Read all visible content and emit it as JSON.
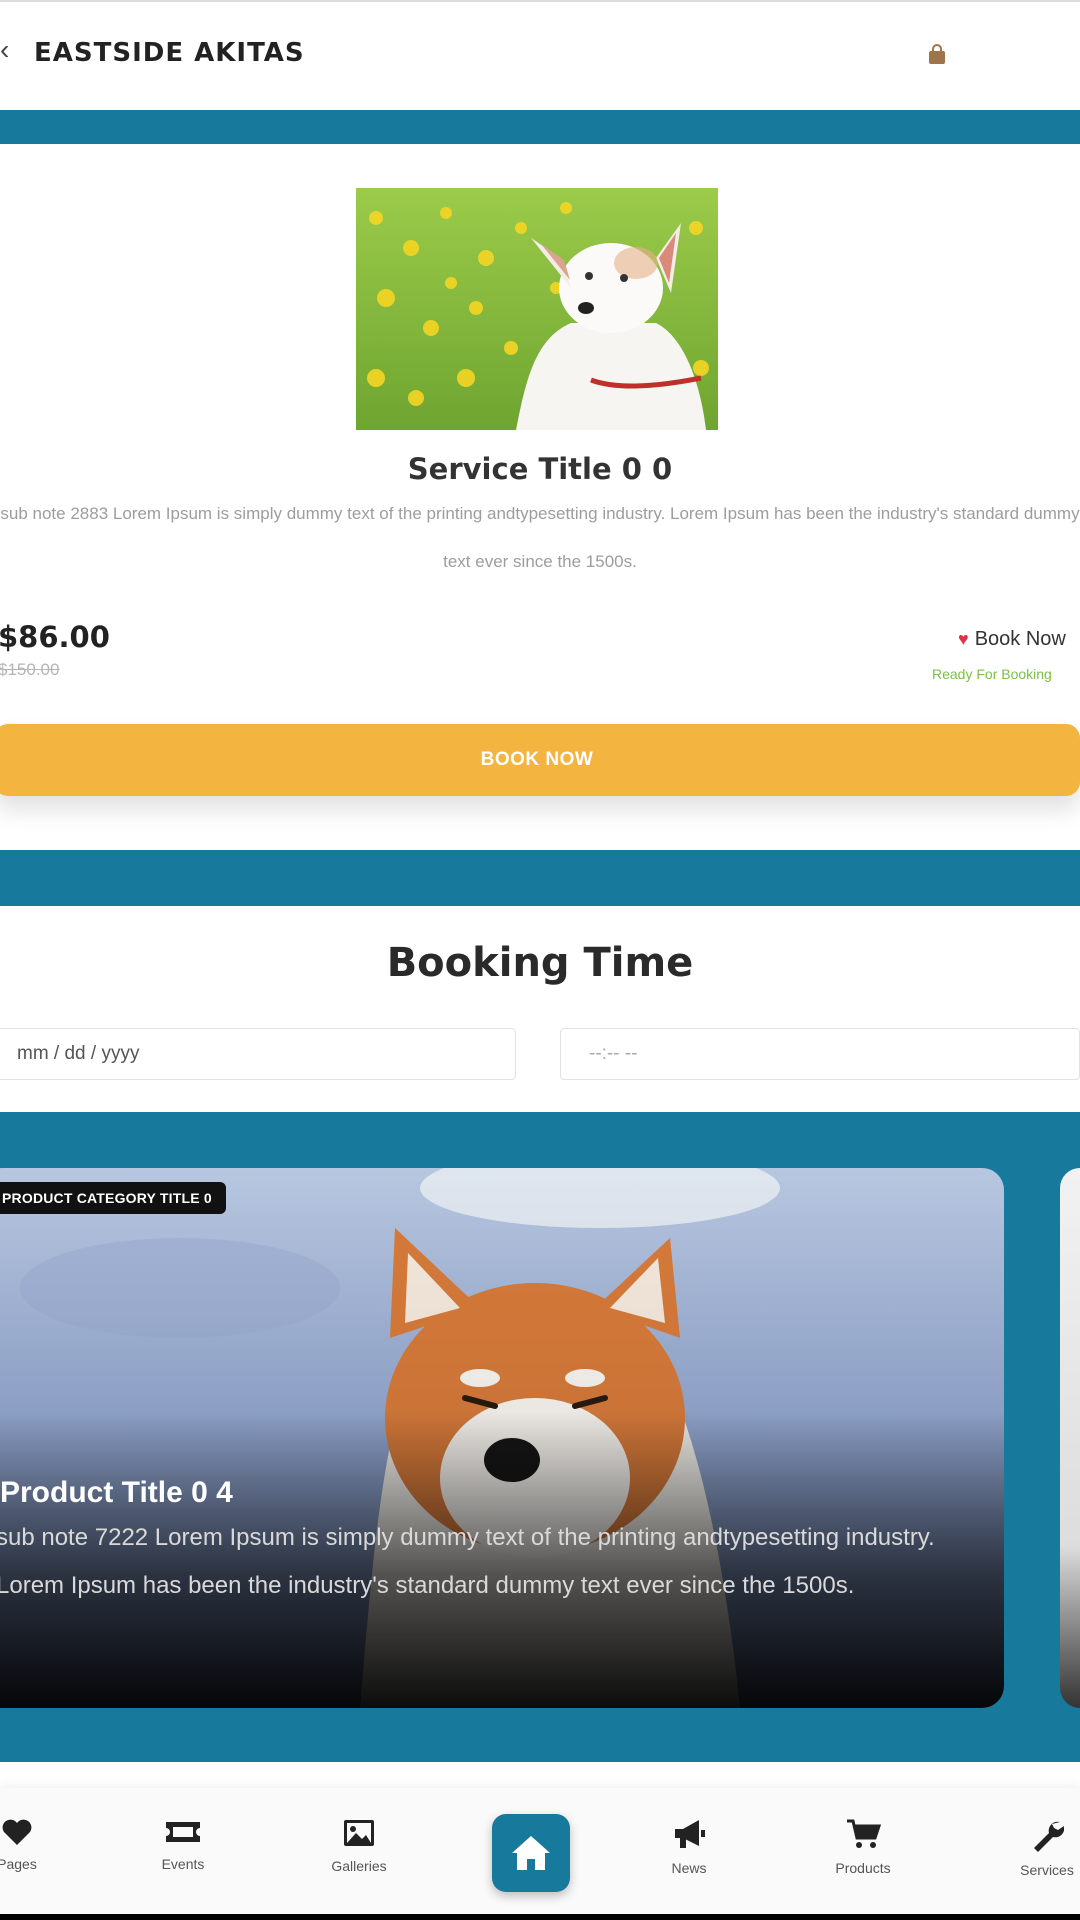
{
  "header": {
    "title": "EASTSIDE AKITAS"
  },
  "service": {
    "title": "Service Title 0 0",
    "sub_note": "sub note 2883 Lorem Ipsum is simply dummy text of the printing andtypesetting industry. Lorem Ipsum has been the industry's standard dummy text ever since the 1500s.",
    "price": "$86.00",
    "old_price": "$150.00",
    "book_link": "Book Now",
    "status": "Ready For Booking",
    "book_button": "BOOK NOW"
  },
  "booking": {
    "title": "Booking Time",
    "date_placeholder": "mm / dd / yyyy",
    "time_placeholder": "--:-- --"
  },
  "product": {
    "category": "PRODUCT CATEGORY TITLE 0",
    "title": "Product Title 0 4",
    "sub_note": "sub note 7222 Lorem Ipsum is simply dummy text of the printing andtypesetting industry. Lorem Ipsum has been the industry's standard dummy text ever since the 1500s."
  },
  "nav": {
    "items": [
      {
        "label": "Pages",
        "icon": "heart-icon"
      },
      {
        "label": "Events",
        "icon": "ticket-icon"
      },
      {
        "label": "Galleries",
        "icon": "image-icon"
      },
      {
        "label": "",
        "icon": "home-icon"
      },
      {
        "label": "News",
        "icon": "megaphone-icon"
      },
      {
        "label": "Products",
        "icon": "cart-icon"
      },
      {
        "label": "Services",
        "icon": "wrench-icon"
      }
    ]
  },
  "colors": {
    "brand": "#177a9c",
    "accent": "#f3b540",
    "heart": "#e0304d",
    "ready": "#7bc043"
  }
}
